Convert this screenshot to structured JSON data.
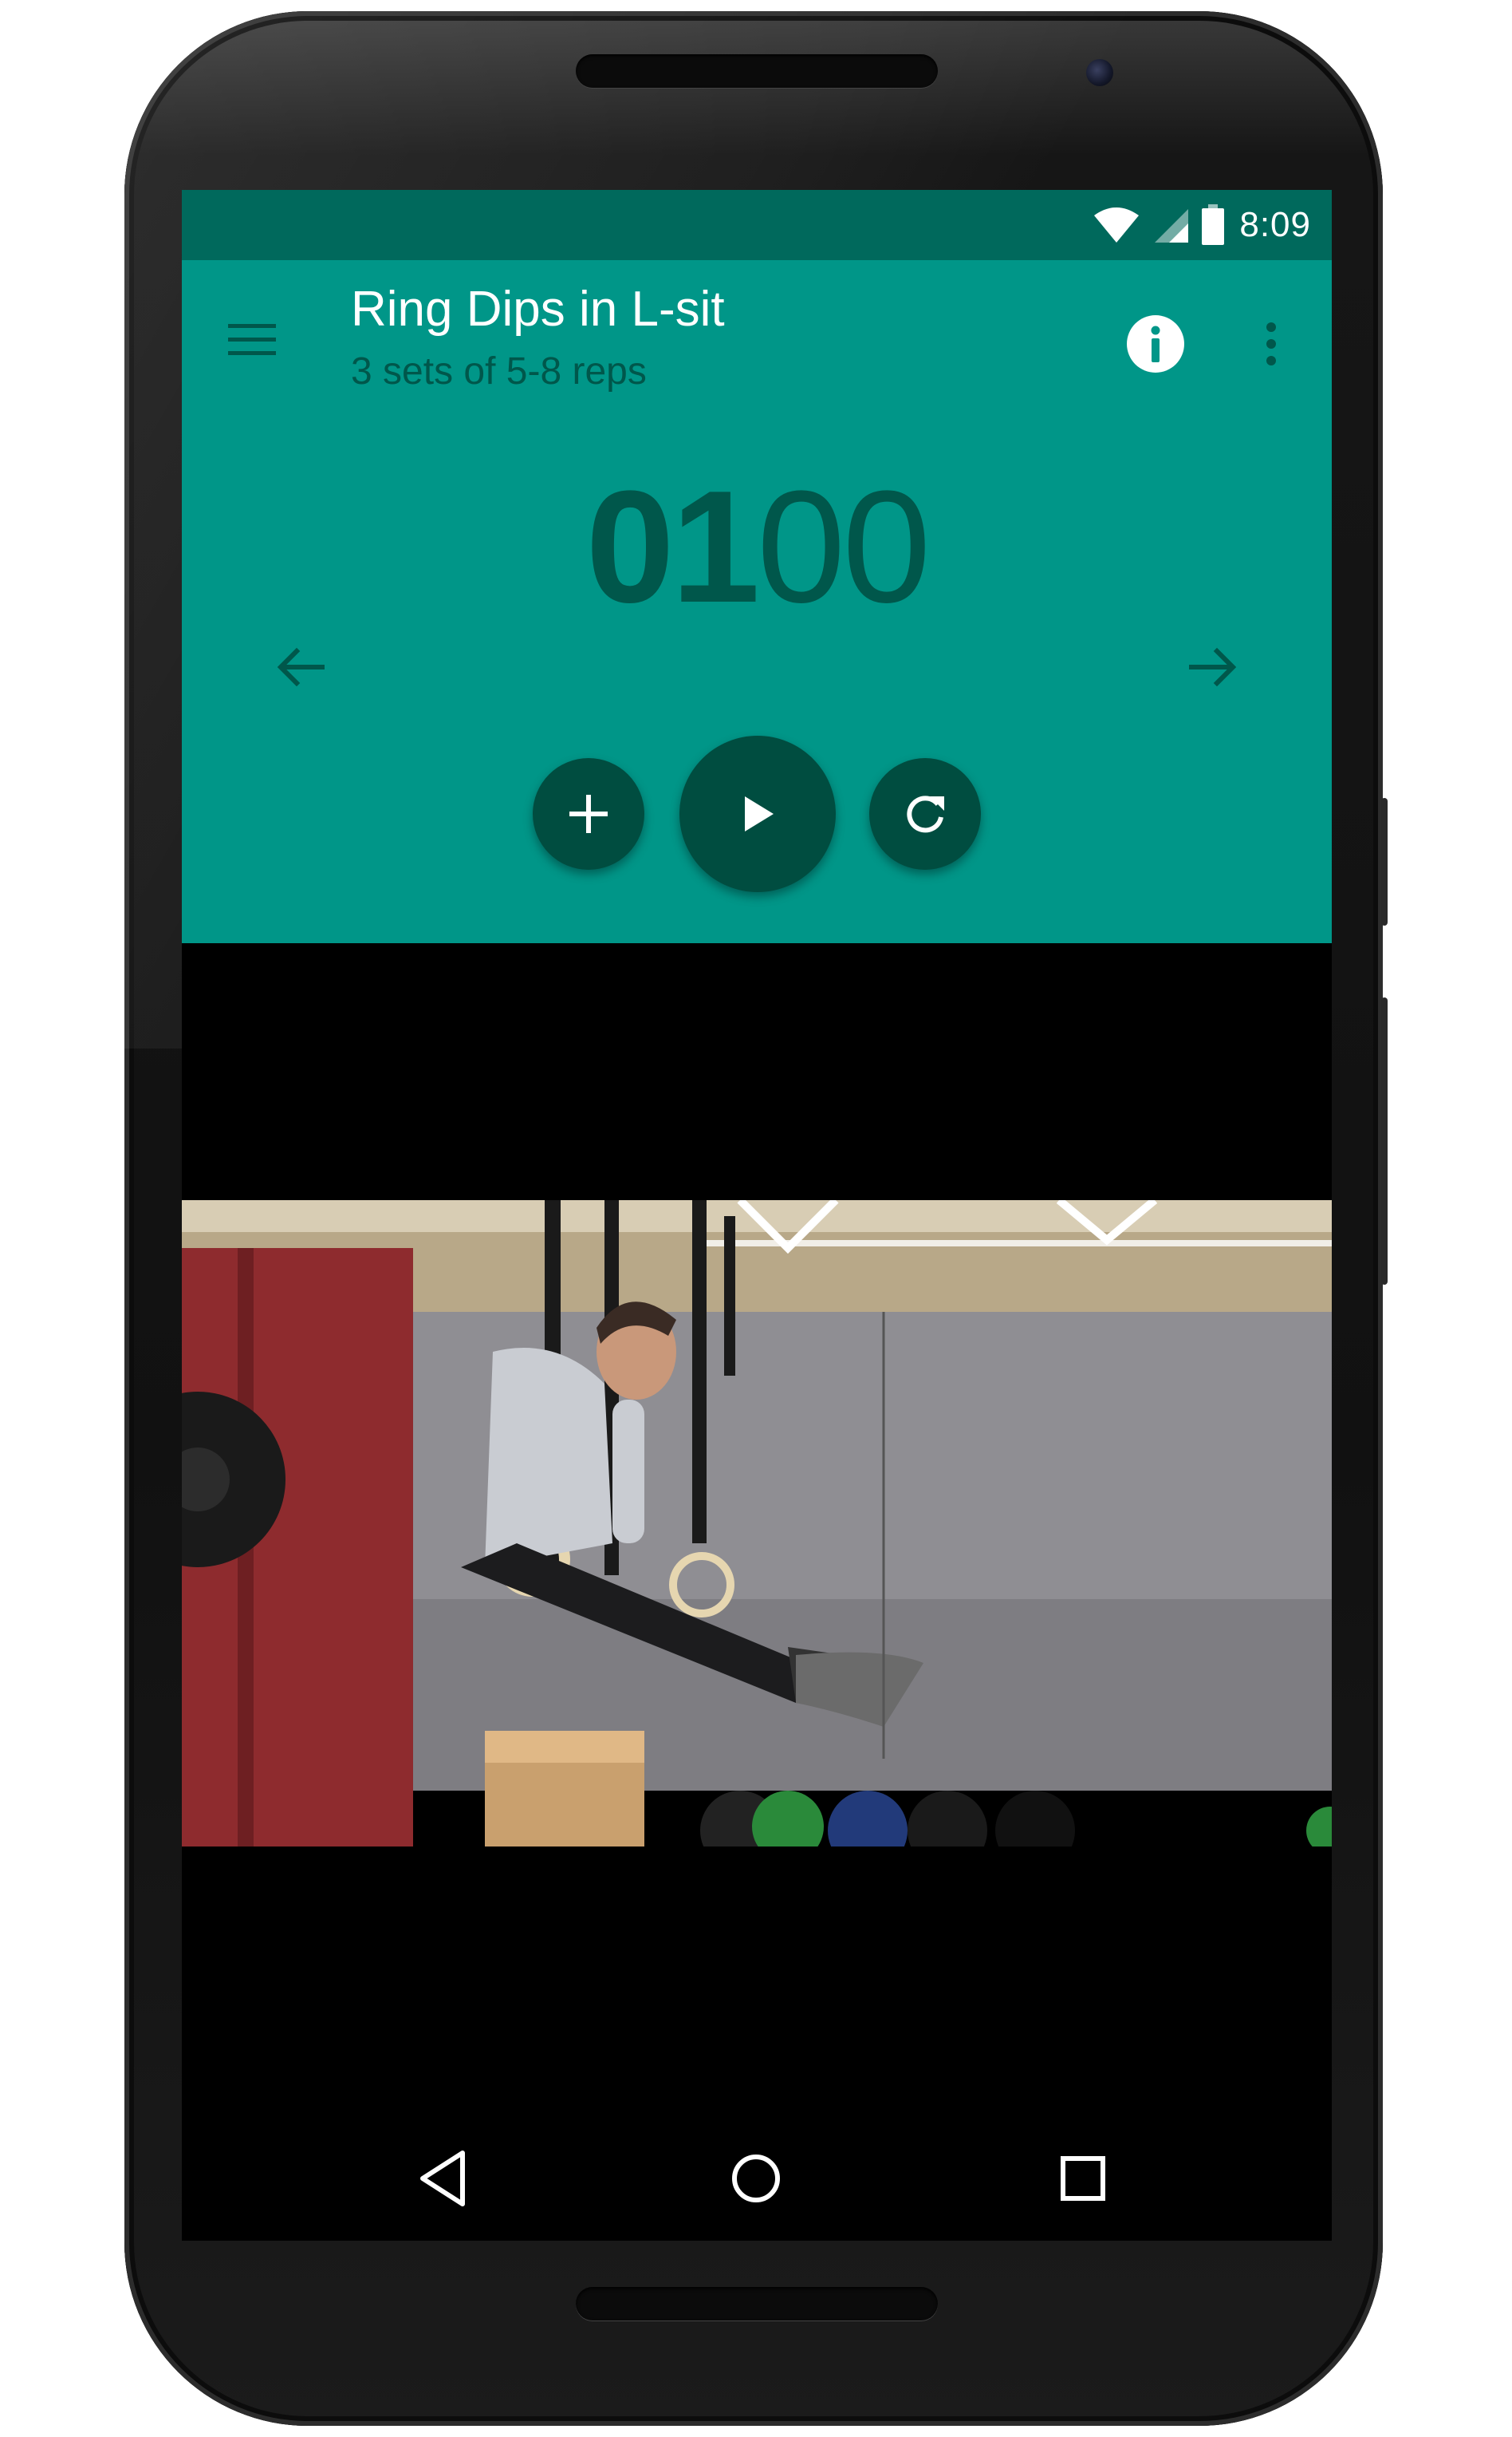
{
  "status_bar": {
    "time": "8:09",
    "icons": [
      "wifi-icon",
      "cell-signal-icon",
      "battery-icon"
    ]
  },
  "app": {
    "title": "Ring Dips in L-sit",
    "subtitle": "3 sets of 5-8 reps",
    "toolbar_icons": [
      "menu-icon",
      "info-icon",
      "more-vert-icon"
    ]
  },
  "timer": {
    "minutes": "01",
    "seconds": "00"
  },
  "controls": {
    "previous": "arrow-back-icon",
    "next": "arrow-forward-icon",
    "add": "add-icon",
    "play": "play-icon",
    "reset": "refresh-icon"
  },
  "nav_bar": {
    "buttons": [
      "back-icon",
      "home-icon",
      "recents-icon"
    ]
  },
  "colors": {
    "primary": "#009688",
    "primary_dark": "#00695c",
    "accent_dark": "#004d40",
    "timer_text": "#00574b"
  }
}
